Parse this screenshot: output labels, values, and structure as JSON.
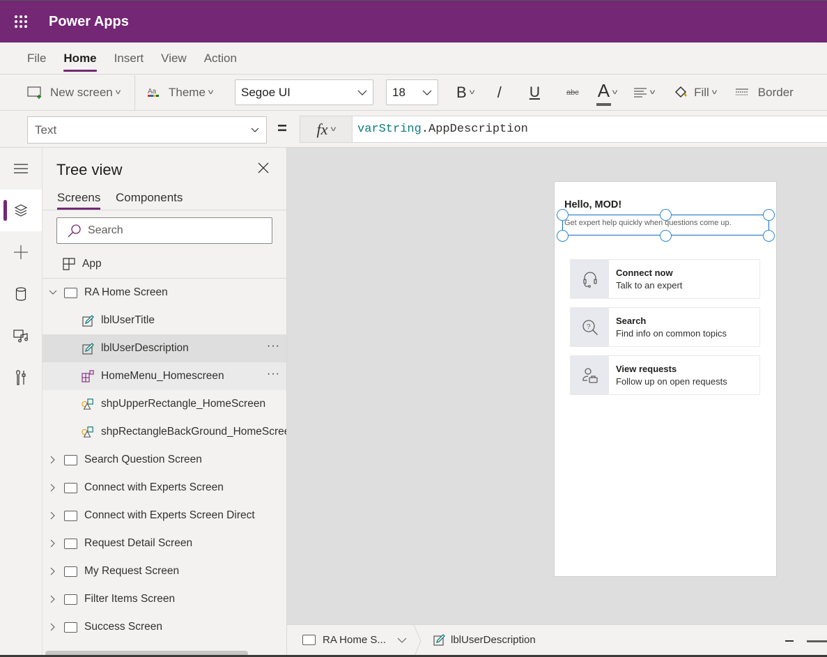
{
  "app": {
    "title": "Power Apps",
    "brand_color": "#742774"
  },
  "menu": {
    "tabs": [
      {
        "label": "File",
        "active": false
      },
      {
        "label": "Home",
        "active": true
      },
      {
        "label": "Insert",
        "active": false
      },
      {
        "label": "View",
        "active": false
      },
      {
        "label": "Action",
        "active": false
      }
    ]
  },
  "ribbon": {
    "new_screen": "New screen",
    "theme": "Theme",
    "font_family": "Segoe UI",
    "font_size": "18",
    "bold_glyph": "B",
    "italic_glyph": "/",
    "underline_glyph": "U",
    "strike_glyph": "abc",
    "font_color_glyph": "A",
    "fill": "Fill",
    "border": "Border"
  },
  "formula": {
    "property": "Text",
    "equals": "=",
    "fx": "fx",
    "expression_var": "varString",
    "expression_rest": ".AppDescription"
  },
  "rail": {
    "items": [
      "menu",
      "tree-view",
      "insert",
      "data",
      "media",
      "advanced-tools"
    ]
  },
  "tree": {
    "title": "Tree view",
    "tabs": [
      {
        "label": "Screens",
        "active": true
      },
      {
        "label": "Components",
        "active": false
      }
    ],
    "search_placeholder": "Search",
    "app_label": "App",
    "items": [
      {
        "label": "RA Home Screen",
        "type": "screen",
        "expanded": true
      },
      {
        "label": "lblUserTitle",
        "type": "label"
      },
      {
        "label": "lblUserDescription",
        "type": "label",
        "selected": true
      },
      {
        "label": "HomeMenu_Homescreen",
        "type": "component"
      },
      {
        "label": "shpUpperRectangle_HomeScreen",
        "type": "shape"
      },
      {
        "label": "shpRectangleBackGround_HomeScreen",
        "type": "shape"
      },
      {
        "label": "Search Question Screen",
        "type": "screen",
        "expanded": false
      },
      {
        "label": "Connect with Experts Screen",
        "type": "screen",
        "expanded": false
      },
      {
        "label": "Connect with Experts Screen Direct",
        "type": "screen",
        "expanded": false
      },
      {
        "label": "Request Detail Screen",
        "type": "screen",
        "expanded": false
      },
      {
        "label": "My Request Screen",
        "type": "screen",
        "expanded": false
      },
      {
        "label": "Filter Items Screen",
        "type": "screen",
        "expanded": false
      },
      {
        "label": "Success Screen",
        "type": "screen",
        "expanded": false
      }
    ],
    "more_glyph": "···"
  },
  "canvas": {
    "greeting": "Hello, MOD!",
    "description": "Get expert help quickly when questions come up.",
    "menu_cards": [
      {
        "icon": "headset-icon",
        "title": "Connect now",
        "subtitle": "Talk to an expert"
      },
      {
        "icon": "search-question-icon",
        "title": "Search",
        "subtitle": "Find info on common topics"
      },
      {
        "icon": "person-briefcase-icon",
        "title": "View requests",
        "subtitle": "Follow up on open requests"
      }
    ]
  },
  "status": {
    "screen_crumb": "RA Home S...",
    "control_crumb": "lblUserDescription"
  }
}
